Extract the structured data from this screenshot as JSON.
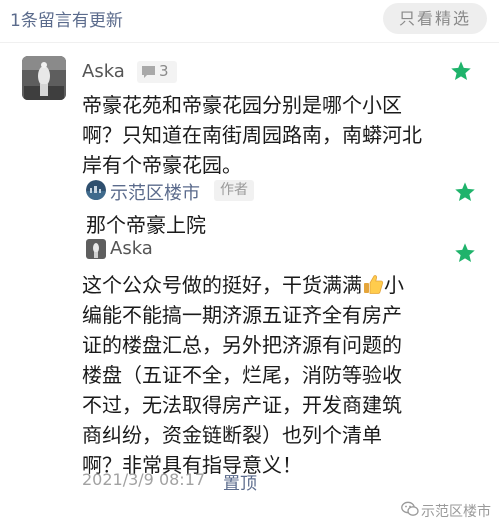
{
  "header": {
    "comment_count": "1条留言有更新",
    "filter_label": "只看精选"
  },
  "comment": {
    "username": "Aska",
    "like_count": "3",
    "text": "帝豪花苑和帝豪花园分别是哪个小区啊？只知道在南街周园路南，南蟒河北岸有个帝豪花园。",
    "starred": true
  },
  "replies": [
    {
      "name": "示范区楼市",
      "tag": "作者",
      "text": "那个帝豪上院",
      "starred": true
    },
    {
      "name": "Aska",
      "text_before_emoji": "这个公众号做的挺好，干货满满",
      "emoji": "thumbs-up",
      "text_after_emoji": "小编能不能搞一期济源五证齐全有房产证的楼盘汇总，另外把济源有问题的楼盘（五证不全，烂尾，消防等验收不过，无法取得房产证，开发商建筑商纠纷，资金链断裂）也列个清单啊？非常具有指导意义！",
      "starred": true
    }
  ],
  "footer": {
    "timestamp": "2021/3/9 08:17",
    "pin_label": "置顶"
  },
  "watermark": {
    "text": "示范区楼市"
  },
  "colors": {
    "star": "#1fb36b",
    "link": "#5b6b8c",
    "muted": "#a2a2a2"
  }
}
